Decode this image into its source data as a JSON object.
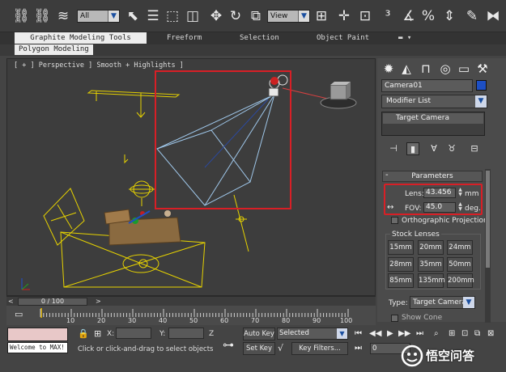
{
  "colors": {
    "accent_red": "#d81f26",
    "camera_line": "#9fc7ea",
    "helper_yellow": "#e6d200",
    "object_color": "#1d4fc4"
  },
  "toolbar": {
    "filter_value": "All",
    "refcoord_value": "View",
    "icons": [
      "link-icon",
      "unlink-icon",
      "bind-spacewarp-icon",
      "select-icon",
      "select-by-name-icon",
      "rect-region-icon",
      "window-crossing-icon",
      "move-icon",
      "rotate-icon",
      "scale-icon",
      "pivot-icon",
      "manipulate-icon",
      "keyboard-shortcut-icon",
      "snaps-icon",
      "angle-snap-icon",
      "percent-snap-icon",
      "spinner-snap-icon"
    ]
  },
  "ribbon": {
    "tabs": [
      "Graphite Modeling Tools",
      "Freeform",
      "Selection",
      "Object Paint"
    ],
    "panel_label": "Polygon Modeling"
  },
  "viewport": {
    "label": "[ + ] Perspective ] Smooth + Highlights ]"
  },
  "command_panel": {
    "tab_icons": [
      "create-icon",
      "modify-icon",
      "hierarchy-icon",
      "motion-icon",
      "display-icon",
      "utilities-icon"
    ],
    "object_name": "Camera01",
    "modifier_list": "Modifier List",
    "stack_item": "Target Camera",
    "parameters": {
      "title": "Parameters",
      "lens_label": "Lens:",
      "lens_value": "43.456",
      "lens_unit": "mm",
      "fov_label": "FOV:",
      "fov_value": "45.0",
      "fov_unit": "deg.",
      "ortho_label": "Orthographic Projection",
      "stock_title": "Stock Lenses",
      "stock_lenses": [
        "15mm",
        "20mm",
        "24mm",
        "28mm",
        "35mm",
        "50mm",
        "85mm",
        "135mm",
        "200mm"
      ],
      "type_label": "Type:",
      "type_value": "Target Camera",
      "show_cone": "Show Cone"
    }
  },
  "timeline": {
    "frame_display": "0 / 100",
    "ticks": [
      "0",
      "10",
      "20",
      "30",
      "40",
      "50",
      "60",
      "70",
      "80",
      "90",
      "100"
    ]
  },
  "status": {
    "welcome": "Welcome to MAX!",
    "x_label": "X:",
    "y_label": "Y:",
    "prompt": "Click or click-and-drag to select objects",
    "auto_key": "Auto Key",
    "set_key": "Set Key",
    "selected": "Selected",
    "key_filters": "Key Filters...",
    "frame_value": "0"
  },
  "watermark": {
    "text": "悟空问答"
  }
}
